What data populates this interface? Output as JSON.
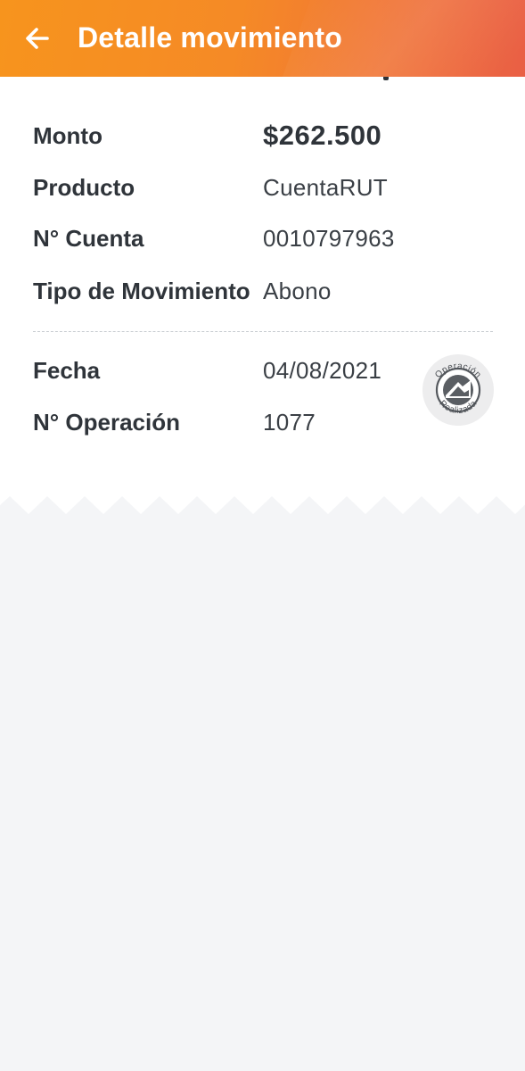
{
  "header": {
    "title": "Detalle movimiento",
    "back_icon": "arrow-left-icon",
    "gradient_colors": [
      "#f7941d",
      "#e95f45"
    ]
  },
  "details": {
    "amount": {
      "label": "Monto",
      "value": "$262.500"
    },
    "product": {
      "label": "Producto",
      "value": "CuentaRUT"
    },
    "account": {
      "label": "N° Cuenta",
      "value": "0010797963"
    },
    "movement_type": {
      "label": "Tipo de Movimiento",
      "value": "Abono"
    },
    "date": {
      "label": "Fecha",
      "value": "04/08/2021"
    },
    "operation": {
      "label": "N° Operación",
      "value": "1077"
    }
  },
  "stamp": {
    "icon": "operation-stamp-icon",
    "top_text": "Operación",
    "bottom_text": "Realizada"
  },
  "colors": {
    "text_dark": "#2f343a",
    "background": "#f4f5f7",
    "card": "#ffffff"
  }
}
